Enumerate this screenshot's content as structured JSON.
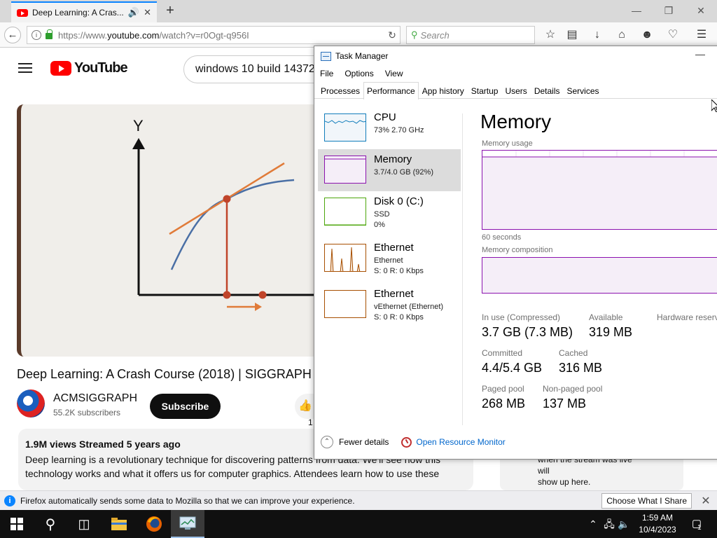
{
  "browser": {
    "tab_title": "Deep Learning: A Cras...",
    "tab_audio_icon": "speaker-icon",
    "new_tab_label": "+",
    "url_prefix": "https://www.",
    "url_domain": "youtube.com",
    "url_rest": "/watch?v=r0Ogt-q956I",
    "search_placeholder": "Search",
    "accent_color": "#0a84ff"
  },
  "youtube": {
    "logo_text": "YouTube",
    "search_value": "windows 10 build 14372",
    "video_axis_label": "Y",
    "video_title": "Deep Learning: A Crash Course (2018) | SIGGRAPH",
    "channel_name": "ACMSIGGRAPH",
    "channel_subs": "55.2K subscribers",
    "subscribe_label": "Subscribe",
    "like_count": "1",
    "desc_meta": "1.9M views  Streamed 5 years ago",
    "desc_text": "Deep learning is a revolutionary technique for discovering patterns from data. We'll see how this technology works and what it offers us for computer graphics. Attendees learn how to use these",
    "side_note_line1": "when the stream was live will",
    "side_note_line2": "show up here."
  },
  "notification": {
    "text": "Firefox automatically sends some data to Mozilla so that we can improve your experience.",
    "button": "Choose What I Share"
  },
  "taskbar": {
    "time": "1:59 AM",
    "date": "10/4/2023",
    "notification_count": "1"
  },
  "task_manager": {
    "title": "Task Manager",
    "menu": [
      "File",
      "Options",
      "View"
    ],
    "tabs": [
      "Processes",
      "Performance",
      "App history",
      "Startup",
      "Users",
      "Details",
      "Services"
    ],
    "active_tab": "Performance",
    "resources": [
      {
        "name": "CPU",
        "line1": "73%  2.70 GHz",
        "line2": ""
      },
      {
        "name": "Memory",
        "line1": "3.7/4.0 GB (92%)",
        "line2": ""
      },
      {
        "name": "Disk 0 (C:)",
        "line1": "SSD",
        "line2": "0%"
      },
      {
        "name": "Ethernet",
        "line1": "Ethernet",
        "line2": "S: 0  R: 0 Kbps"
      },
      {
        "name": "Ethernet",
        "line1": "vEthernet (Ethernet)",
        "line2": "S: 0  R: 0 Kbps"
      }
    ],
    "memory": {
      "heading": "Memory",
      "usage_label": "Memory usage",
      "seconds_label": "60 seconds",
      "composition_label": "Memory composition",
      "usage_fraction": 0.92,
      "in_use_label": "In use (Compressed)",
      "in_use_value": "3.7 GB (7.3 MB)",
      "available_label": "Available",
      "available_value": "319 MB",
      "hw_reserved_label": "Hardware reserved",
      "committed_label": "Committed",
      "committed_value": "4.4/5.4 GB",
      "cached_label": "Cached",
      "cached_value": "316 MB",
      "paged_label": "Paged pool",
      "paged_value": "268 MB",
      "nonpaged_label": "Non-paged pool",
      "nonpaged_value": "137 MB"
    },
    "fewer_details": "Fewer details",
    "open_resource_monitor": "Open Resource Monitor",
    "memory_color": "#8b12ae",
    "cpu_color": "#117dbb",
    "disk_color": "#4da60c",
    "ethernet_color": "#a74f01"
  }
}
